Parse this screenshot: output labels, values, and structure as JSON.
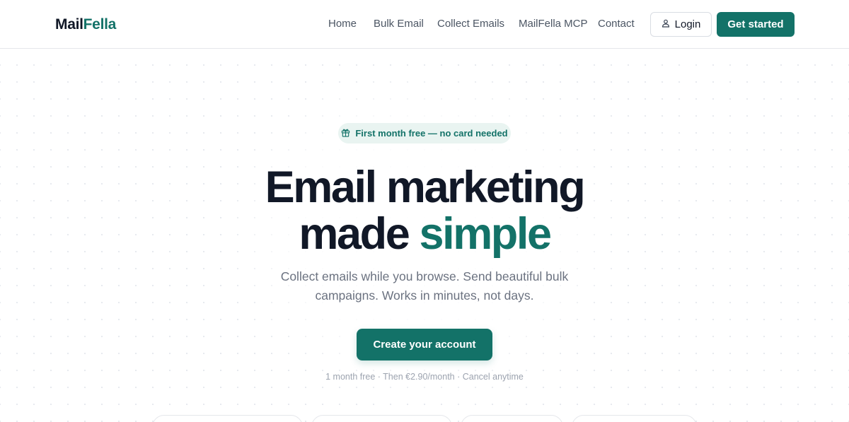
{
  "brand": {
    "name_part1": "Mail",
    "name_part2": "Fella",
    "accent_color": "#137268"
  },
  "nav": {
    "items": [
      {
        "label": "Home"
      },
      {
        "label": "Bulk Email"
      },
      {
        "label": "Collect Emails"
      },
      {
        "label": "MailFella MCP"
      },
      {
        "label": "Contact"
      }
    ],
    "login_label": "Login",
    "login_icon": "user-icon",
    "get_started_label": "Get started"
  },
  "hero": {
    "badge_icon": "gift-icon",
    "badge_text": "First month free — no card needed",
    "title_line1": "Email marketing",
    "title_line2_plain": "made ",
    "title_line2_accent": "simple",
    "subtitle_line1": "Collect emails while you browse. Send beautiful bulk",
    "subtitle_line2": "campaigns. Works in minutes, not days.",
    "cta_label": "Create your account",
    "fine_print": "1 month free · Then €2.90/month · Cancel anytime"
  }
}
